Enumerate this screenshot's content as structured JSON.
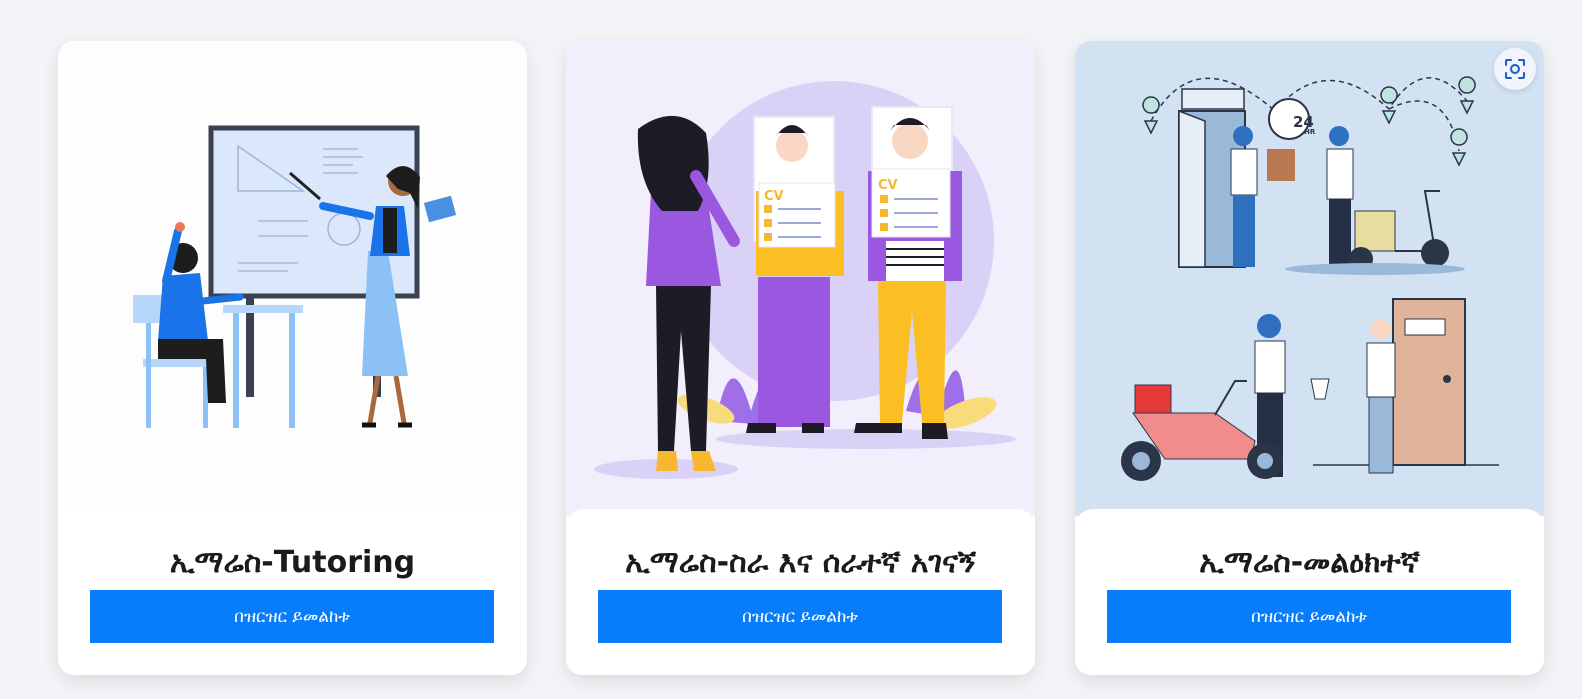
{
  "cards": [
    {
      "title": "ኢማሬስ-Tutoring",
      "button_label": "በዝርዝር ይመልከቱ",
      "illustration": "tutoring-illustration"
    },
    {
      "title": "ኢማሬስ-ስራ እና ሰራተኛ አገናኝ",
      "button_label": "በዝርዝር ይመልከቱ",
      "illustration": "job-matching-illustration"
    },
    {
      "title": "ኢማሬስ-መልዕክተኛ",
      "button_label": "በዝርዝር ይመልከቱ",
      "illustration": "delivery-illustration"
    }
  ],
  "illustration_text": {
    "cv": "CV",
    "delivery_hours": "24",
    "delivery_unit": "HR"
  },
  "overlay": {
    "icon": "lens-search-icon"
  },
  "colors": {
    "accent": "#087dfb",
    "card_bg": "#ffffff",
    "page_bg": "#f3f4f7"
  }
}
